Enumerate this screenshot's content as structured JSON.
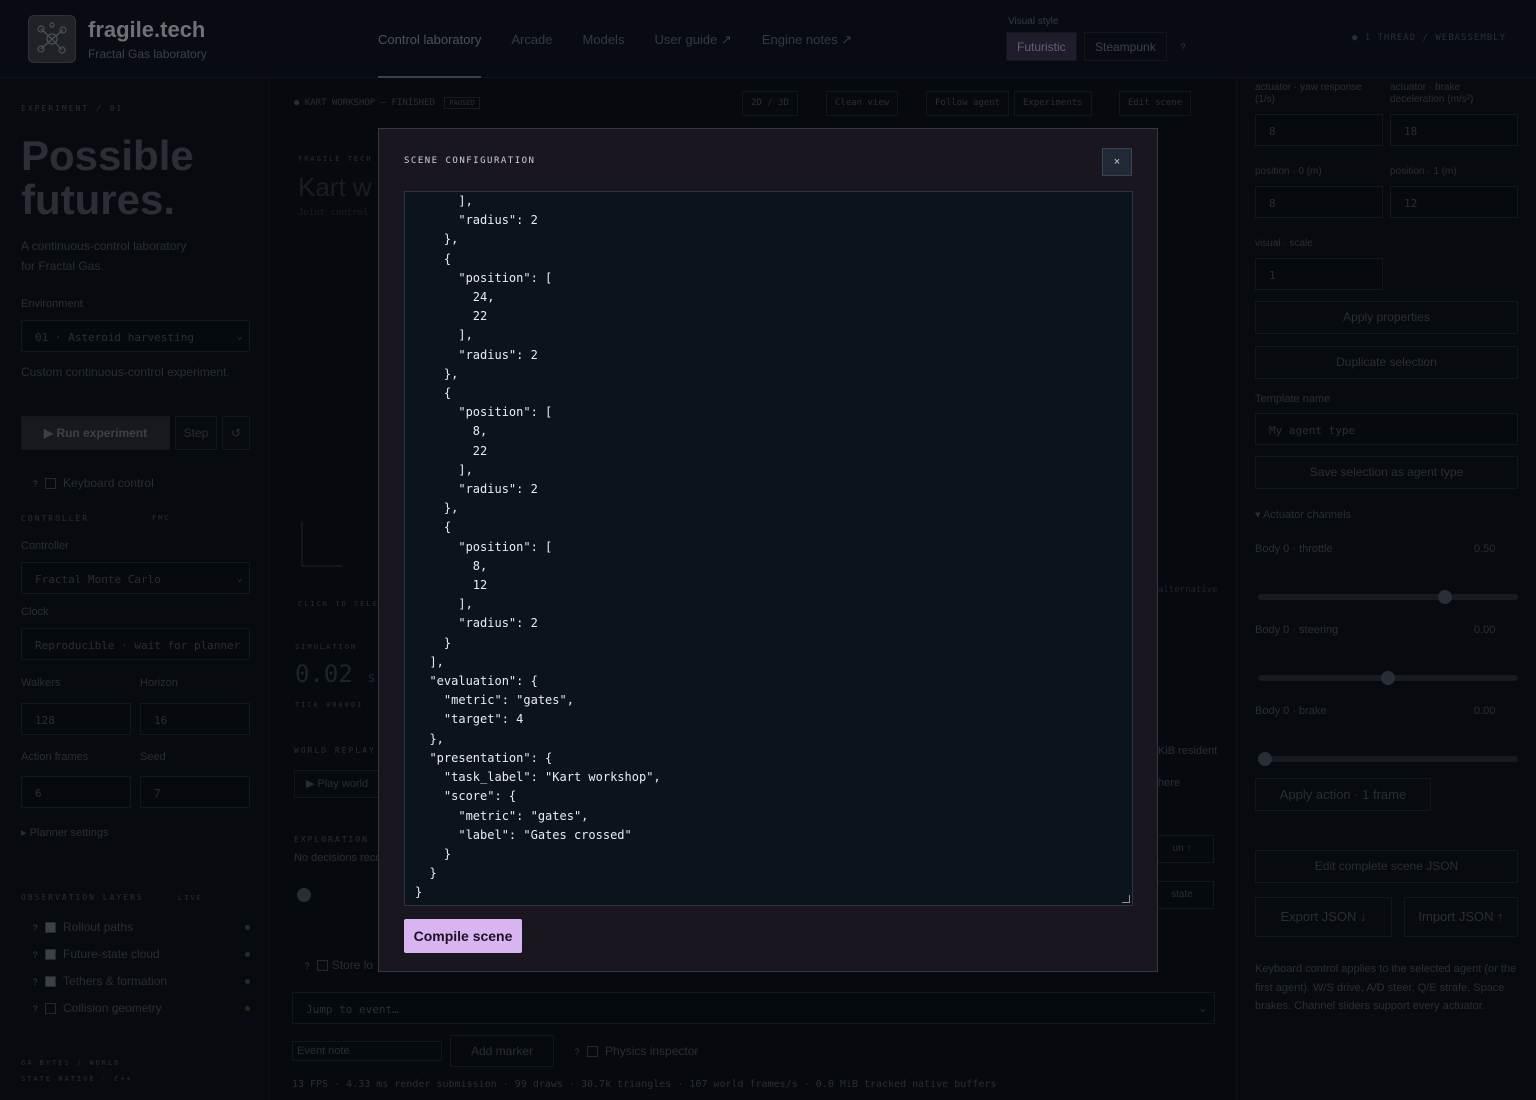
{
  "header": {
    "brand": "fragile.tech",
    "brand_sub": "Fractal Gas laboratory",
    "nav": [
      "Control laboratory",
      "Arcade",
      "Models",
      "User guide ↗",
      "Engine notes ↗"
    ],
    "visual_style_label": "Visual style",
    "style_options": [
      "Futuristic",
      "Steampunk"
    ],
    "selected_style": "Futuristic",
    "thread_status": "1 THREAD / WEBASSEMBLY"
  },
  "left": {
    "experiment_tag": "EXPERIMENT / 01",
    "title_line1": "Possible",
    "title_line2": "futures.",
    "subtitle_line1": "A continuous-control laboratory",
    "subtitle_line2": "for Fractal Gas.",
    "environment_label": "Environment",
    "environment_value": "01 · Asteroid harvesting",
    "environment_desc": "Custom continuous-control experiment.",
    "run_label": "▶ Run experiment",
    "step_label": "Step",
    "reset_icon": "↺",
    "keyboard_label": "Keyboard control",
    "controller_heading": "CONTROLLER",
    "controller_tag": "FMC",
    "controller_label": "Controller",
    "controller_value": "Fractal Monte Carlo",
    "clock_label": "Clock",
    "clock_value": "Reproducible · wait for planner",
    "walkers_label": "Walkers",
    "walkers_value": "128",
    "horizon_label": "Horizon",
    "horizon_value": "16",
    "action_frames_label": "Action frames",
    "action_frames_value": "6",
    "seed_label": "Seed",
    "seed_value": "7",
    "planner_settings": "▸ Planner settings",
    "obs_heading": "OBSERVATION LAYERS",
    "obs_tag": "LIVE",
    "layers": [
      {
        "label": "Rollout paths",
        "checked": true
      },
      {
        "label": "Future-state cloud",
        "checked": true
      },
      {
        "label": "Tethers & formation",
        "checked": true
      },
      {
        "label": "Collision geometry",
        "checked": false
      }
    ],
    "footer_line1": "64 BYTES / WORLD",
    "footer_line2": "STATE NATIVE · C++"
  },
  "center": {
    "status": "KART WORKSHOP — FINISHED",
    "paused_badge": "PAUSED",
    "toolbar": [
      "2D / 3D",
      "Clean view",
      "Follow agent",
      "Experiments",
      "Edit scene"
    ],
    "bg_title": "Kart w",
    "bg_label_top": "FRAGILE TECH",
    "bg_sub": "Joint control",
    "click_hint": "CLICK TO SELECT",
    "alternative": "alternative",
    "sim_label": "SIMULATION",
    "sim_value": "0.02",
    "sim_unit": "s",
    "tick": "TICK 000001",
    "world_replay": "WORLD REPLAY",
    "play_world": "▶ Play world",
    "resident": "KiB resident",
    "here": "here",
    "exploration": "EXPLORATION",
    "no_decisions": "No decisions reco",
    "run_up": "un ↑",
    "state": "state",
    "store_label": "Store lo",
    "jump_placeholder": "Jump to event…",
    "event_note_placeholder": "Event note",
    "add_marker": "Add marker",
    "physics_inspector": "Physics inspector",
    "stats": "13 FPS · 4.33 ms render submission · 99 draws · 30.7k triangles · 107 world frames/s · 0.0 MiB tracked native buffers"
  },
  "right": {
    "yaw_label": "actuator · yaw response (1/s)",
    "brake_label": "actuator · brake deceleration (m/s²)",
    "yaw_value": "8",
    "brake_value": "18",
    "pos0_label": "position · 0 (m)",
    "pos1_label": "position · 1 (m)",
    "pos0_value": "8",
    "pos1_value": "12",
    "scale_label": "visual · scale",
    "scale_value": "1",
    "apply_properties": "Apply properties",
    "duplicate_selection": "Duplicate selection",
    "template_label": "Template name",
    "template_placeholder": "My agent type",
    "save_type": "Save selection as agent type",
    "actuator_channels": "▾ Actuator channels",
    "channels": [
      {
        "label": "Body 0 · throttle",
        "value": "0.50",
        "level": 0.73
      },
      {
        "label": "Body 0 · steering",
        "value": "0.00",
        "level": 0.5
      },
      {
        "label": "Body 0 · brake",
        "value": "0.00",
        "level": 0.0
      }
    ],
    "apply_action": "Apply action · 1 frame",
    "edit_json": "Edit complete scene JSON",
    "export_json": "Export JSON ↓",
    "import_json": "Import JSON ↑",
    "help_text": "Keyboard control applies to the selected agent (or the first agent). W/S drive, A/D steer, Q/E strafe, Space brakes. Channel sliders support every actuator."
  },
  "modal": {
    "title": "SCENE CONFIGURATION",
    "close_label": "×",
    "code": "      ],\n      \"radius\": 2\n    },\n    {\n      \"position\": [\n        24,\n        22\n      ],\n      \"radius\": 2\n    },\n    {\n      \"position\": [\n        8,\n        22\n      ],\n      \"radius\": 2\n    },\n    {\n      \"position\": [\n        8,\n        12\n      ],\n      \"radius\": 2\n    }\n  ],\n  \"evaluation\": {\n    \"metric\": \"gates\",\n    \"target\": 4\n  },\n  \"presentation\": {\n    \"task_label\": \"Kart workshop\",\n    \"score\": {\n      \"metric\": \"gates\",\n      \"label\": \"Gates crossed\"\n    }\n  }\n}",
    "compile_label": "Compile scene"
  }
}
